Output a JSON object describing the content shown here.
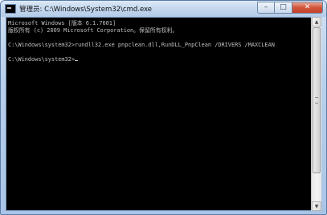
{
  "window": {
    "title": "管理员: C:\\Windows\\System32\\cmd.exe",
    "controls": {
      "minimize": "–",
      "maximize": "□",
      "close": "✕"
    }
  },
  "console": {
    "lines": [
      "Microsoft Windows [版本 6.1.7601]",
      "版权所有 (c) 2009 Microsoft Corporation。保留所有权利。",
      "",
      "C:\\Windows\\system32>rundll32.exe pnpclean.dll,RunDLL_PnpClean /DRIVERS /MAXCLEAN",
      "",
      "C:\\Windows\\system32>"
    ]
  },
  "scrollbar": {
    "up_arrow": "▲",
    "down_arrow": "▼"
  },
  "colors": {
    "console_bg": "#000000",
    "console_text": "#c0c0c0",
    "close_button": "#c8452d"
  },
  "icons": {
    "app": "cmd-icon",
    "minimize": "minimize-icon",
    "maximize": "maximize-icon",
    "close": "close-icon"
  }
}
